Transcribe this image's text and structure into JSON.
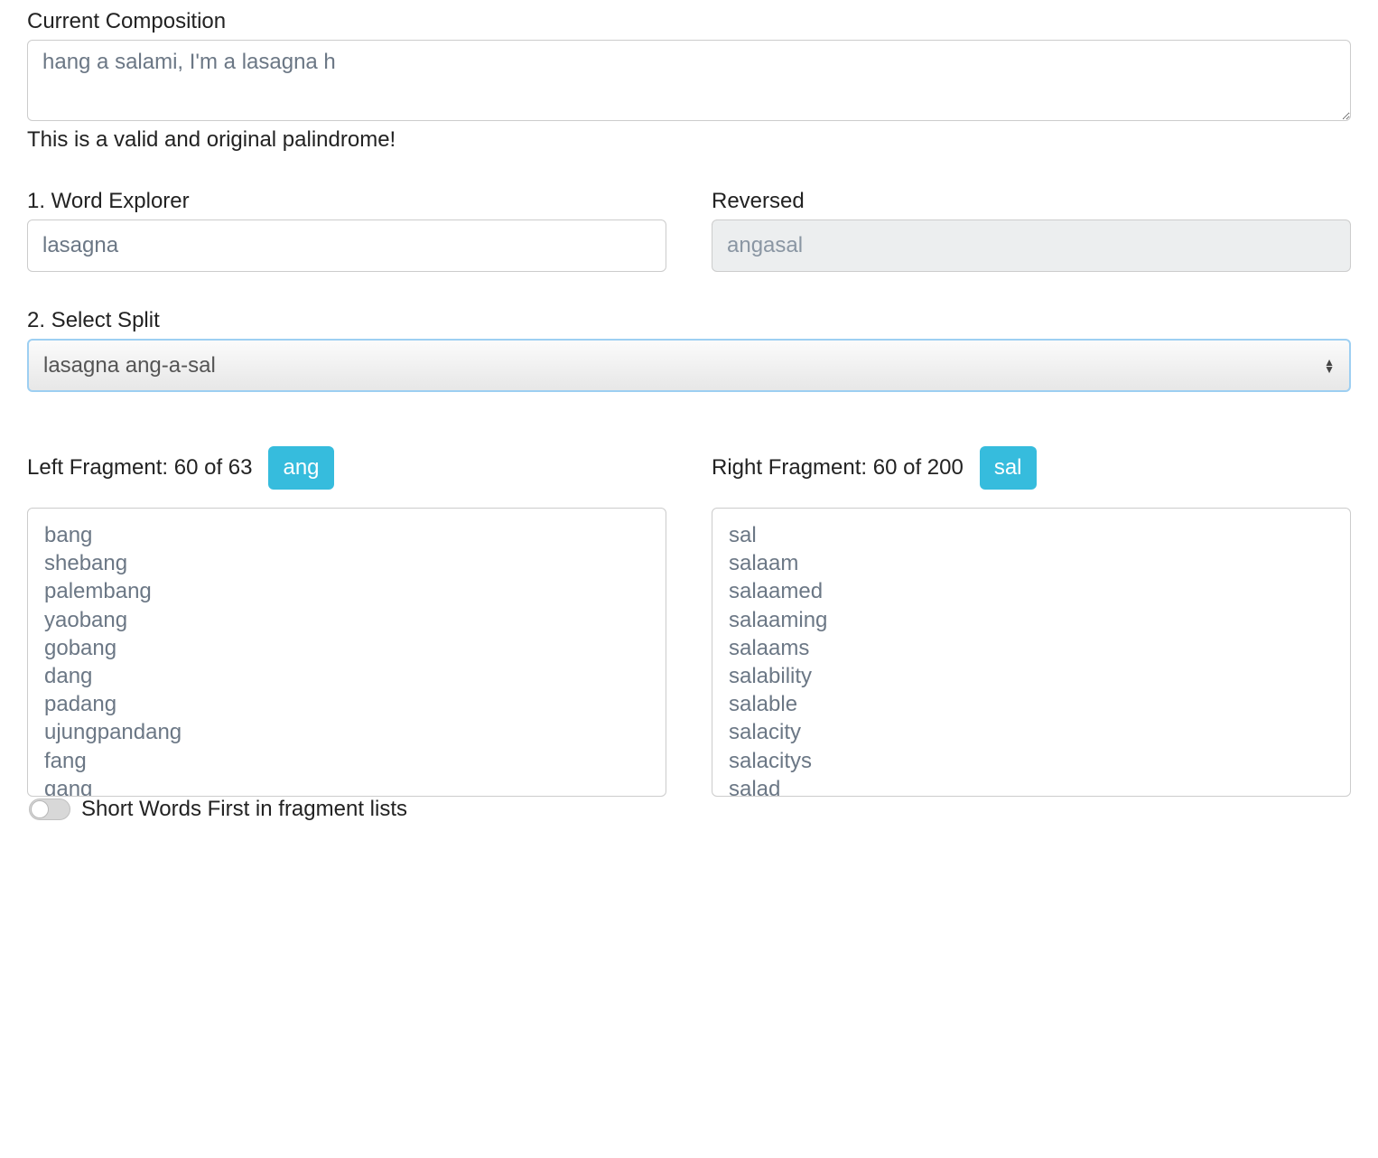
{
  "composition": {
    "label": "Current Composition",
    "value": "hang a salami, I'm a lasagna h"
  },
  "status": "This is a valid and original palindrome!",
  "wordExplorer": {
    "label": "1. Word Explorer",
    "value": "lasagna"
  },
  "reversed": {
    "label": "Reversed",
    "value": "angasal"
  },
  "split": {
    "label": "2. Select Split",
    "selected": "lasagna ang-a-sal"
  },
  "leftFragment": {
    "label": "Left Fragment: 60 of 63",
    "badge": "ang",
    "items": [
      "bang",
      "shebang",
      "palembang",
      "yaobang",
      "gobang",
      "dang",
      "padang",
      "ujungpandang",
      "fang",
      "gang"
    ]
  },
  "rightFragment": {
    "label": "Right Fragment: 60 of 200",
    "badge": "sal",
    "items": [
      "sal",
      "salaam",
      "salaamed",
      "salaaming",
      "salaams",
      "salability",
      "salable",
      "salacity",
      "salacitys",
      "salad"
    ]
  },
  "toggle": {
    "label": "Short Words First in fragment lists",
    "on": false
  }
}
